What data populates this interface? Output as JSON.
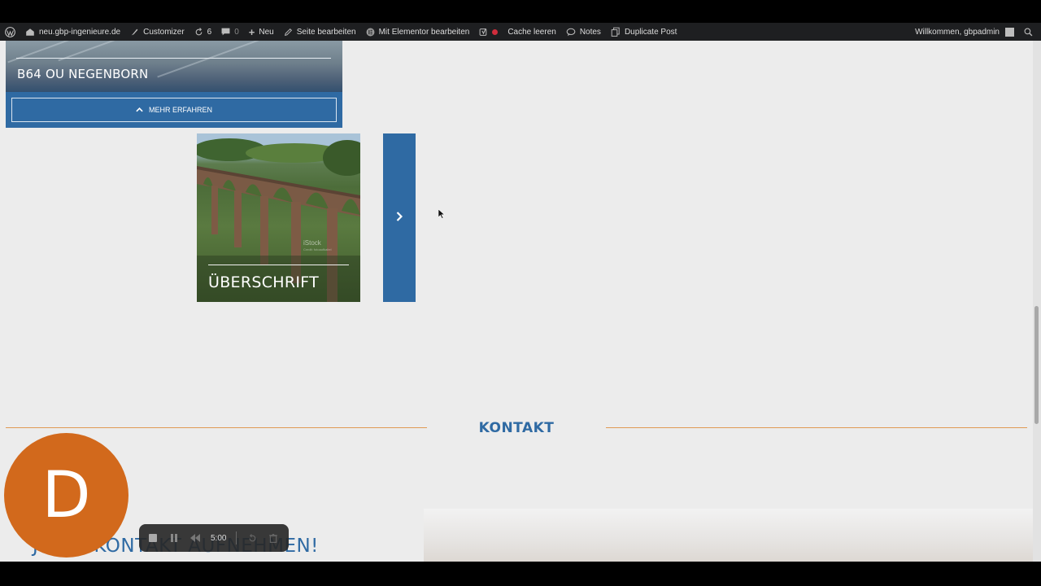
{
  "adminbar": {
    "site": "neu.gbp-ingenieure.de",
    "customizer": "Customizer",
    "updates_count": "6",
    "comments_count": "0",
    "new": "Neu",
    "edit_page": "Seite bearbeiten",
    "elementor": "Mit Elementor bearbeiten",
    "cache": "Cache leeren",
    "notes": "Notes",
    "duplicate": "Duplicate Post",
    "welcome": "Willkommen, gbpadmin"
  },
  "project_card": {
    "title": "B64 OU NEGENBORN",
    "more_button": "MEHR ERFAHREN"
  },
  "bridge_card": {
    "title": "ÜBERSCHRIFT",
    "watermark": "iStock",
    "watermark_sub": "Credit: fotoaufkaltel"
  },
  "contact": {
    "heading": "KONTAKT",
    "cta": "JETZT KONTAKT AUFNEHMEN!"
  },
  "presenter": {
    "initial": "D",
    "color": "#d2691c"
  },
  "recorder": {
    "time": "5:00"
  },
  "colors": {
    "brand_blue": "#2f6aa3",
    "accent_orange_line": "#e09a54",
    "adminbar_bg": "#1e1f21"
  }
}
